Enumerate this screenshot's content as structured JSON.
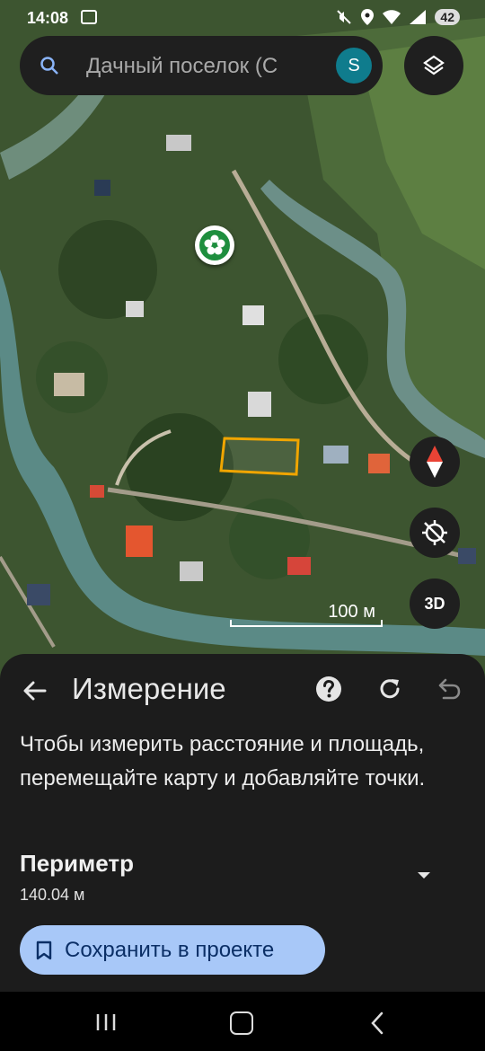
{
  "status_bar": {
    "time": "14:08",
    "battery": "42"
  },
  "search": {
    "query": "Дачный поселок (С",
    "avatar_letter": "S"
  },
  "map": {
    "scale_label": "100 м",
    "mode_3d_label": "3D"
  },
  "measure_panel": {
    "title": "Измерение",
    "instructions": "Чтобы измерить расстояние и площадь, перемещайте карту и добавляйте точки.",
    "metric_label": "Периметр",
    "metric_value": "140.04 м",
    "save_label": "Сохранить в проекте"
  },
  "colors": {
    "panel_bg": "#1c1c1c",
    "save_button_bg": "#a8c8f8",
    "avatar_bg": "#0f7c8d",
    "measure_outline": "#f0a500",
    "marker_green": "#1e8e3e"
  },
  "icons": {
    "search": "search-icon",
    "layers": "layers-icon",
    "compass": "compass-icon",
    "location": "location-off-icon",
    "back": "arrow-back-icon",
    "help": "help-icon",
    "reset": "refresh-icon",
    "undo": "undo-icon",
    "dropdown": "chevron-down-icon",
    "bookmark": "bookmark-icon"
  }
}
